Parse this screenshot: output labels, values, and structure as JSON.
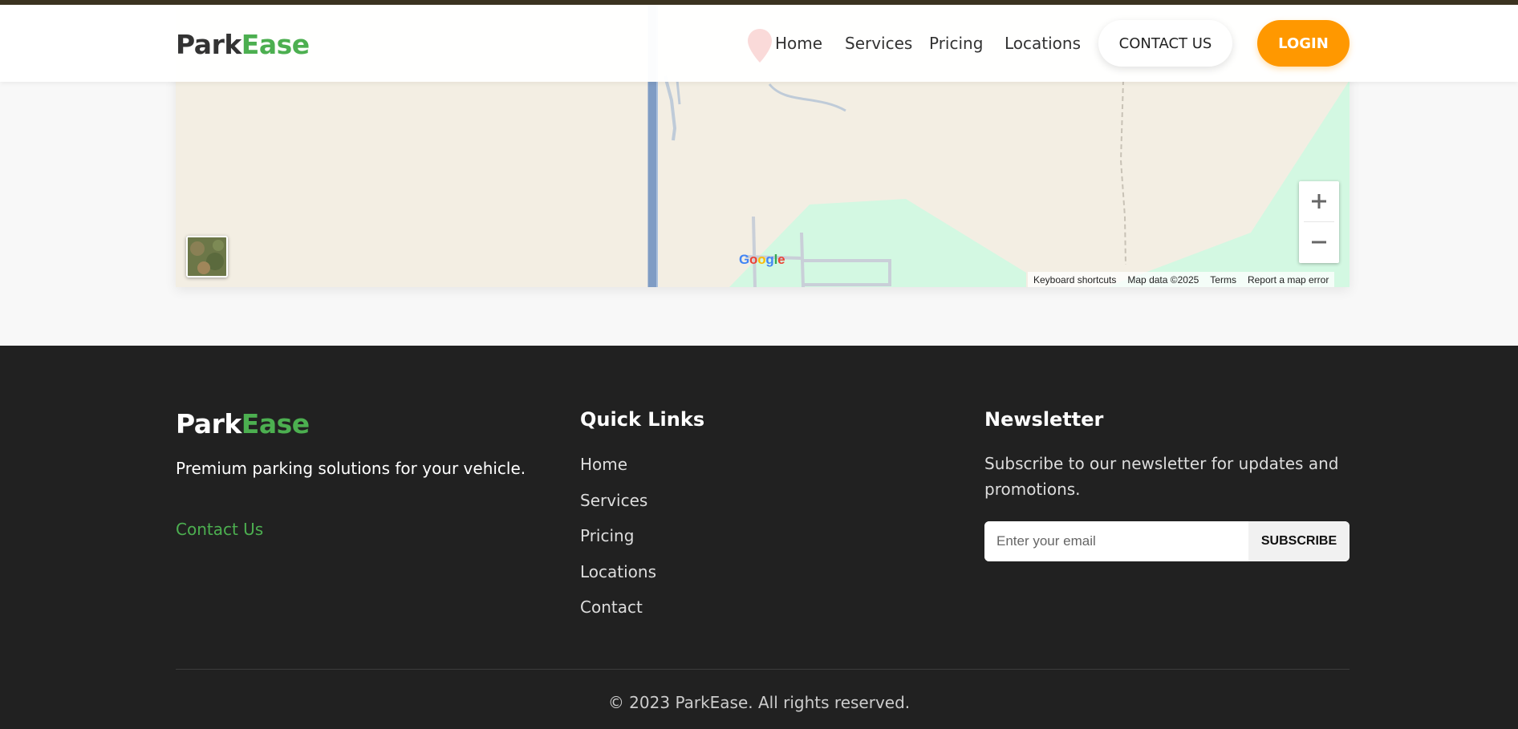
{
  "brand": {
    "part1": "Park",
    "part2": "Ease",
    "accent": "#4caf50"
  },
  "header": {
    "nav": [
      "Home",
      "Services",
      "Pricing",
      "Locations"
    ],
    "contact_label": "CONTACT US",
    "login_label": "LOGIN",
    "login_color": "#ff9800"
  },
  "map": {
    "google_logo": "Google",
    "attribution": [
      "Keyboard shortcuts",
      "Map data ©2025",
      "Terms",
      "Report a map error"
    ],
    "zoom_in_icon": "plus-icon",
    "zoom_out_icon": "minus-icon",
    "layer_toggle": "satellite-thumbnail"
  },
  "footer": {
    "tagline": "Premium parking solutions for your vehicle.",
    "contact_link": "Contact Us",
    "quick_links_title": "Quick Links",
    "quick_links": [
      "Home",
      "Services",
      "Pricing",
      "Locations",
      "Contact"
    ],
    "newsletter_title": "Newsletter",
    "newsletter_text": "Subscribe to our newsletter for updates and promotions.",
    "email_placeholder": "Enter your email",
    "subscribe_label": "SUBSCRIBE",
    "copyright": "© 2023 ParkEase. All rights reserved."
  }
}
